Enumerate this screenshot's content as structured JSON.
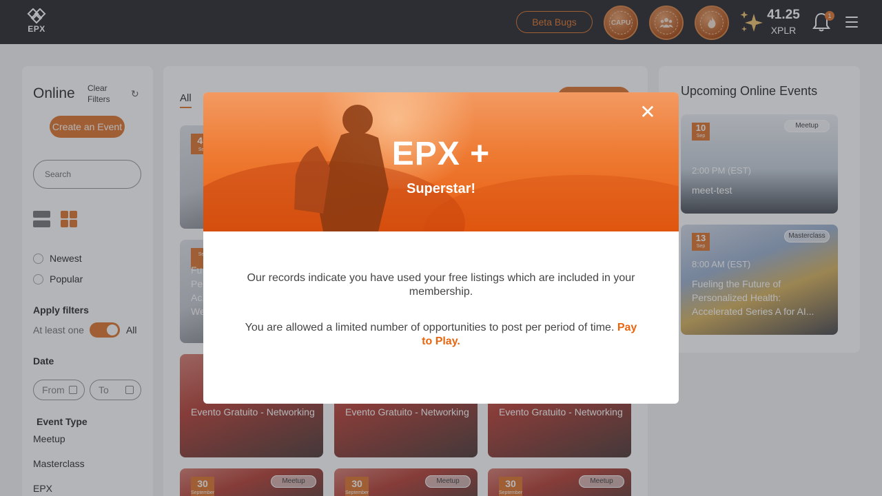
{
  "header": {
    "logo_text": "EPX",
    "beta_label": "Beta Bugs",
    "badges": [
      "CAPU",
      "group-badge",
      "flame-badge"
    ],
    "xplr_amount": "41.25",
    "xplr_unit": "XPLR",
    "notification_count": "1"
  },
  "sidebar": {
    "title": "Online",
    "clear_filters": "Clear Filters",
    "create_event": "Create an Event",
    "search_placeholder": "Search",
    "sort": [
      "Newest",
      "Popular"
    ],
    "apply_filters": "Apply filters",
    "at_least_one": "At least one",
    "all": "All",
    "date_label": "Date",
    "from": "From",
    "to": "To",
    "event_type_label": "Event Type",
    "event_types": [
      "Meetup",
      "Masterclass",
      "EPX"
    ]
  },
  "center": {
    "tab_all": "All",
    "cards": [
      {
        "day": "45",
        "month": "Sep",
        "title": ""
      },
      {
        "day": "",
        "month": "Sep",
        "title": "Fu... Pe... Ac... We..."
      },
      {
        "title": "Evento Gratuito - Networking"
      },
      {
        "title": "Evento Gratuito - Networking"
      },
      {
        "title": "Evento Gratuito - Networking"
      },
      {
        "day": "30",
        "month": "September",
        "tag": "Meetup"
      },
      {
        "day": "30",
        "month": "September",
        "tag": "Meetup"
      },
      {
        "day": "30",
        "month": "September",
        "tag": "Meetup"
      }
    ]
  },
  "right": {
    "title": "Upcoming Online Events",
    "events": [
      {
        "day": "10",
        "month": "Sep",
        "tag": "Meetup",
        "time": "2:00 PM (EST)",
        "name": "meet-test"
      },
      {
        "day": "13",
        "month": "Sep",
        "tag": "Masterclass",
        "time": "8:00 AM (EST)",
        "name": "Fueling the Future of Personalized Health: Accelerated Series A for AI..."
      }
    ]
  },
  "modal": {
    "title": "EPX +",
    "subtitle": "Superstar!",
    "message1": "Our records indicate you have used your free listings which are included in your membership.",
    "message2": "You are allowed a limited number of opportunities to post per period of time.",
    "pay_link": "Pay to Play."
  },
  "colors": {
    "accent": "#e07a35",
    "topbar": "#2f3033",
    "link": "#e8650f"
  }
}
